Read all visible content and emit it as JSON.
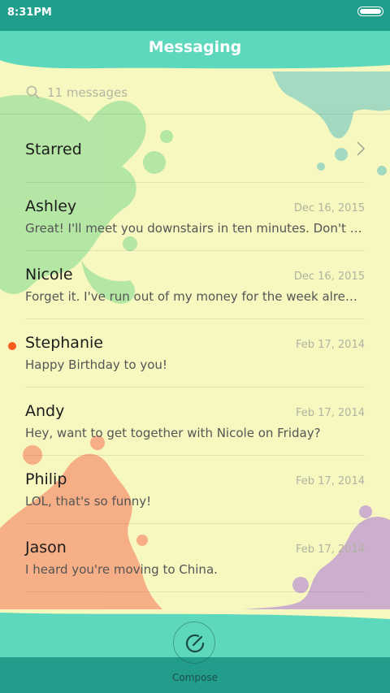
{
  "status_bar": {
    "time": "8:31PM",
    "battery_icon": "battery-icon"
  },
  "header": {
    "title": "Messaging"
  },
  "search": {
    "placeholder": "11 messages",
    "icon": "search-icon"
  },
  "starred": {
    "label": "Starred",
    "icon": "chevron-right-icon"
  },
  "conversations": [
    {
      "name": "Ashley",
      "date": "Dec 16, 2015",
      "snippet": "Great! I'll meet you downstairs in ten minutes. Don't forget",
      "unread": false
    },
    {
      "name": "Nicole",
      "date": "Dec 16, 2015",
      "snippet": "Forget it. I've run out of my money for the week already.",
      "unread": false
    },
    {
      "name": "Stephanie",
      "date": "Feb 17, 2014",
      "snippet": "Happy Birthday to you!",
      "unread": true
    },
    {
      "name": "Andy",
      "date": "Feb 17, 2014",
      "snippet": "Hey, want to get together with Nicole on Friday?",
      "unread": false
    },
    {
      "name": "Philip",
      "date": "Feb 17, 2014",
      "snippet": "LOL, that's so funny!",
      "unread": false
    },
    {
      "name": "Jason",
      "date": "Feb 17, 2014",
      "snippet": "I heard you're moving to China.",
      "unread": false
    }
  ],
  "compose": {
    "label": "Compose",
    "icon": "compose-icon"
  },
  "colors": {
    "status_bar": "#1f9e8c",
    "accent": "#5dd8bc",
    "background": "#f6f8bf",
    "unread_dot": "#fa5a1e",
    "bottom_bar": "#229d8b"
  }
}
